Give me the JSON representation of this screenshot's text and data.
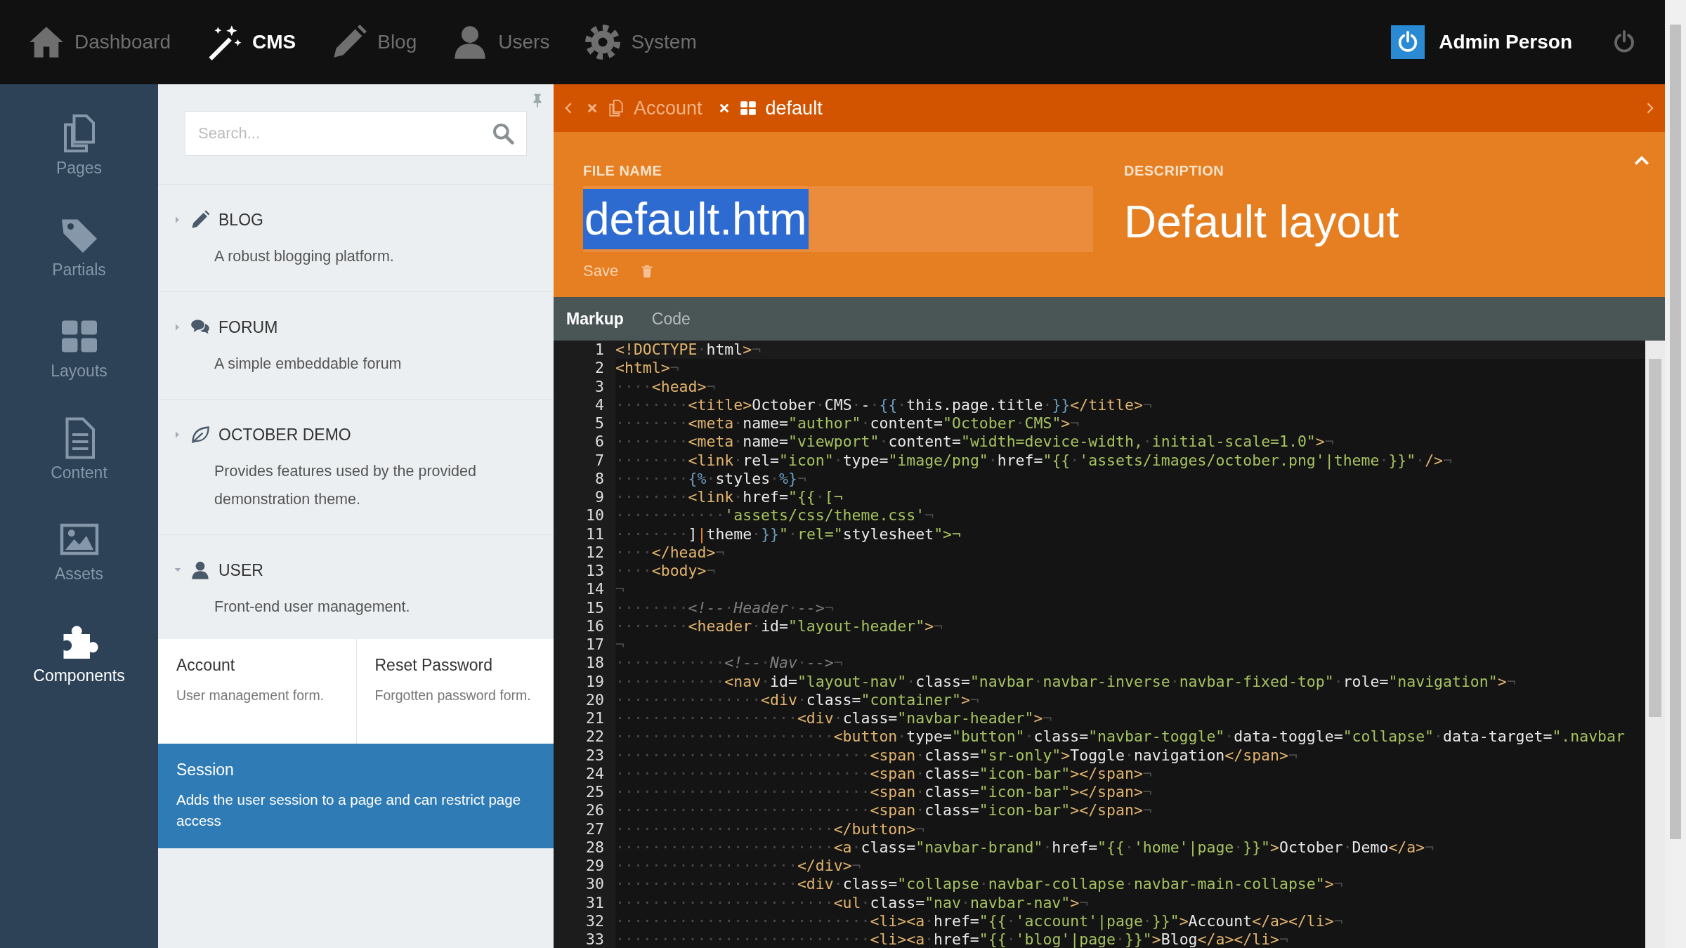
{
  "top_nav": {
    "items": [
      {
        "label": "Dashboard",
        "selected": false
      },
      {
        "label": "CMS",
        "selected": true
      },
      {
        "label": "Blog",
        "selected": false
      },
      {
        "label": "Users",
        "selected": false
      },
      {
        "label": "System",
        "selected": false
      }
    ],
    "user": "Admin Person"
  },
  "sidebar": {
    "items": [
      {
        "label": "Pages",
        "selected": false
      },
      {
        "label": "Partials",
        "selected": false
      },
      {
        "label": "Layouts",
        "selected": false
      },
      {
        "label": "Content",
        "selected": false
      },
      {
        "label": "Assets",
        "selected": false
      },
      {
        "label": "Components",
        "selected": true
      }
    ]
  },
  "plugins_panel": {
    "search": {
      "placeholder": "Search..."
    },
    "plugins": [
      {
        "name": "BLOG",
        "description": "A robust blogging platform.",
        "expanded": false
      },
      {
        "name": "FORUM",
        "description": "A simple embeddable forum",
        "expanded": false
      },
      {
        "name": "OCTOBER DEMO",
        "description": "Provides features used by the provided demonstration theme.",
        "expanded": false
      },
      {
        "name": "USER",
        "description": "Front-end user management.",
        "expanded": true,
        "components": [
          {
            "name": "Account",
            "description": "User management form.",
            "selected": false
          },
          {
            "name": "Reset Password",
            "description": "Forgotten password form.",
            "selected": false
          },
          {
            "name": "Session",
            "description": "Adds the user session to a page and can restrict page access",
            "selected": true
          }
        ]
      }
    ]
  },
  "tabs": [
    {
      "label": "Account",
      "selected": false
    },
    {
      "label": "default",
      "selected": true
    }
  ],
  "form": {
    "file_name_label": "FILE NAME",
    "file_name": "default.htm",
    "description_label": "DESCRIPTION",
    "description": "Default layout",
    "save": "Save"
  },
  "editor_tabs": [
    {
      "label": "Markup",
      "selected": true
    },
    {
      "label": "Code",
      "selected": false
    }
  ],
  "code": {
    "lines": [
      {
        "number": "1",
        "text": "<!DOCTYPE·html>¬"
      },
      {
        "number": "2",
        "text": "<html>¬"
      },
      {
        "number": "3",
        "text": "····<head>¬"
      },
      {
        "number": "4",
        "text": "········<title>October·CMS·-·{{·this.page.title·}}</title>¬"
      },
      {
        "number": "5",
        "text": "········<meta·name=\"author\"·content=\"October·CMS\">¬"
      },
      {
        "number": "6",
        "text": "········<meta·name=\"viewport\"·content=\"width=device-width,·initial-scale=1.0\">¬"
      },
      {
        "number": "7",
        "text": "········<link·rel=\"icon\"·type=\"image/png\"·href=\"{{·'assets/images/october.png'|theme·}}\"·/>¬"
      },
      {
        "number": "8",
        "text": "········{%·styles·%}¬"
      },
      {
        "number": "9",
        "text": "········<link·href=\"{{·[¬"
      },
      {
        "number": "10",
        "text": "············'assets/css/theme.css'¬"
      },
      {
        "number": "11",
        "text": "········]|theme·}}\"·rel=\"stylesheet\">¬"
      },
      {
        "number": "12",
        "text": "····</head>¬"
      },
      {
        "number": "13",
        "text": "····<body>¬"
      },
      {
        "number": "14",
        "text": "¬"
      },
      {
        "number": "15",
        "text": "········<!--·Header·-->¬"
      },
      {
        "number": "16",
        "text": "········<header·id=\"layout-header\">¬"
      },
      {
        "number": "17",
        "text": "¬"
      },
      {
        "number": "18",
        "text": "············<!--·Nav·-->¬"
      },
      {
        "number": "19",
        "text": "············<nav·id=\"layout-nav\"·class=\"navbar·navbar-inverse·navbar-fixed-top\"·role=\"navigation\">¬"
      },
      {
        "number": "20",
        "text": "················<div·class=\"container\">¬"
      },
      {
        "number": "21",
        "text": "····················<div·class=\"navbar-header\">¬"
      },
      {
        "number": "22",
        "text": "························<button·type=\"button\"·class=\"navbar-toggle\"·data-toggle=\"collapse\"·data-target=\".navbar"
      },
      {
        "number": "23",
        "text": "····························<span·class=\"sr-only\">Toggle·navigation</span>¬"
      },
      {
        "number": "24",
        "text": "····························<span·class=\"icon-bar\"></span>¬"
      },
      {
        "number": "25",
        "text": "····························<span·class=\"icon-bar\"></span>¬"
      },
      {
        "number": "26",
        "text": "····························<span·class=\"icon-bar\"></span>¬"
      },
      {
        "number": "27",
        "text": "························</button>¬"
      },
      {
        "number": "28",
        "text": "························<a·class=\"navbar-brand\"·href=\"{{·'home'|page·}}\">October·Demo</a>¬"
      },
      {
        "number": "29",
        "text": "····················</div>¬"
      },
      {
        "number": "30",
        "text": "····················<div·class=\"collapse·navbar-collapse·navbar-main-collapse\">¬"
      },
      {
        "number": "31",
        "text": "························<ul·class=\"nav·navbar-nav\">¬"
      },
      {
        "number": "32",
        "text": "····························<li><a·href=\"{{·'account'|page·}}\">Account</a></li>¬"
      },
      {
        "number": "33",
        "text": "····························<li><a·href=\"{{·'blog'|page·}}\">Blog</a></li>¬"
      }
    ]
  }
}
